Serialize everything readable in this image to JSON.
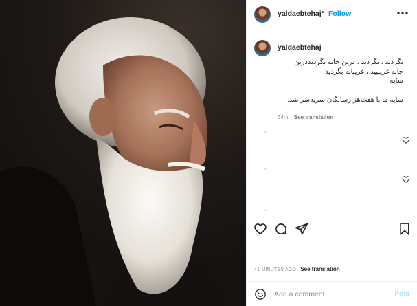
{
  "post": {
    "username": "yaldaebtehaj",
    "follow_label": "Follow",
    "separator": "•",
    "caption_dot": ".",
    "caption_lines": [
      "بگردید ، بگردید ، درین خانه بگردیددرین",
      "خانه غریبیید ، غریبانه بگردید",
      "سایه",
      "سایه ما با هفت‌هزارسالگان سربه‌سر شد."
    ],
    "caption_age": "34m",
    "see_translation": "See translation",
    "timestamp": "41 MINUTES AGO",
    "comment_placeholder": "Add a comment…",
    "post_label": "Post"
  },
  "icons": {
    "more": "more-horizontal-icon",
    "like": "heart-icon",
    "comment": "comment-bubble-icon",
    "share": "paper-plane-icon",
    "save": "bookmark-icon",
    "emoji": "smiley-icon",
    "comment_like": "heart-small-icon"
  },
  "colors": {
    "link_blue": "#0095f6",
    "post_disabled": "#b2dffc",
    "muted_text": "#8e8e8e",
    "divider": "#efefef"
  }
}
